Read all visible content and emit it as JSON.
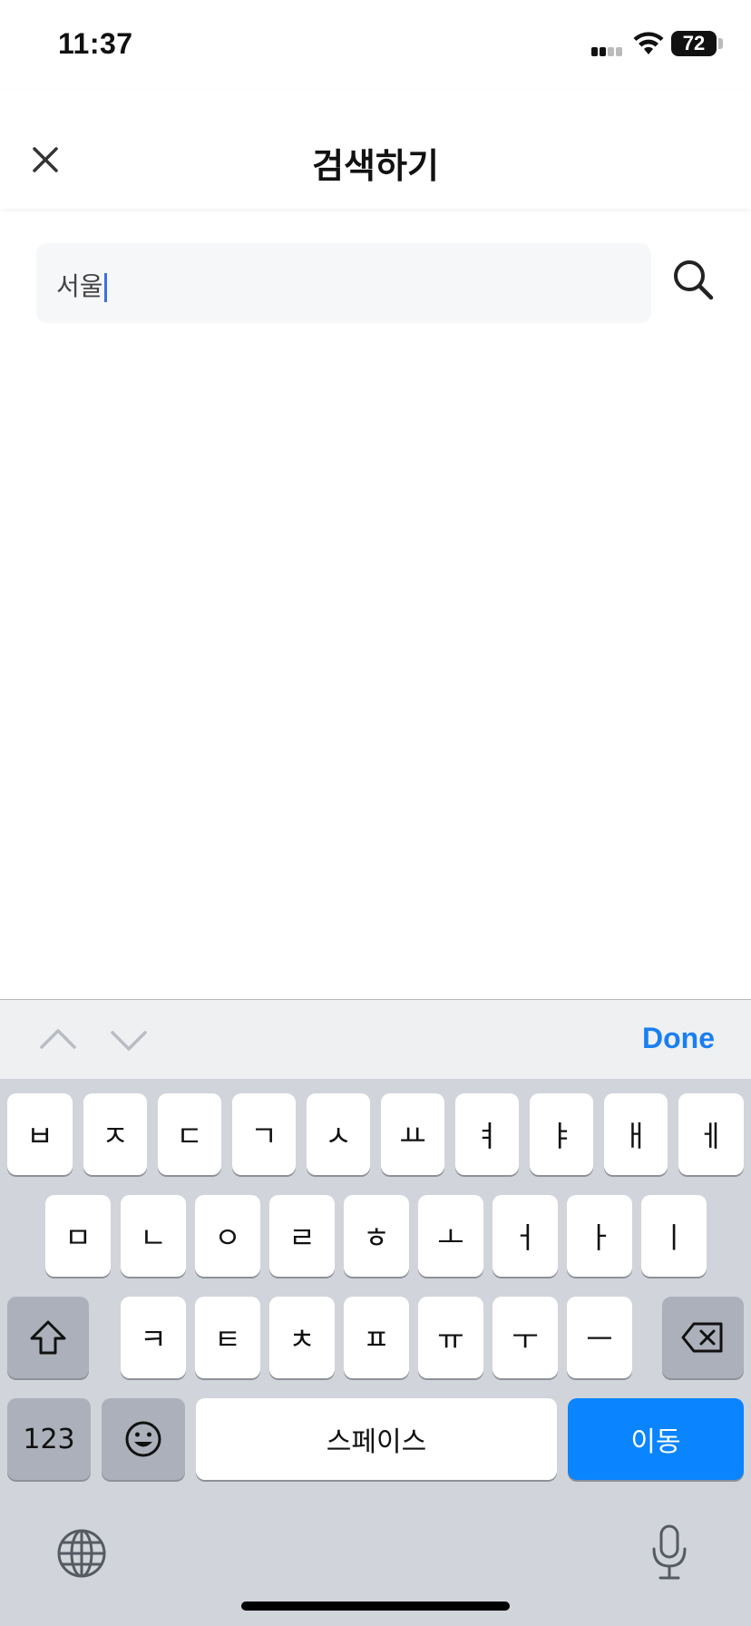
{
  "status_bar": {
    "time": "11:37",
    "battery": "72"
  },
  "header": {
    "title": "검색하기",
    "close_icon": "close-icon"
  },
  "search": {
    "value": "서울",
    "search_icon": "search-icon"
  },
  "toolbar": {
    "prev_icon": "chevron-up-icon",
    "next_icon": "chevron-down-icon",
    "done_label": "Done"
  },
  "keyboard": {
    "row1": [
      "ㅂ",
      "ㅈ",
      "ㄷ",
      "ㄱ",
      "ㅅ",
      "ㅛ",
      "ㅕ",
      "ㅑ",
      "ㅐ",
      "ㅔ"
    ],
    "row2": [
      "ㅁ",
      "ㄴ",
      "ㅇ",
      "ㄹ",
      "ㅎ",
      "ㅗ",
      "ㅓ",
      "ㅏ",
      "ㅣ"
    ],
    "row3": [
      "ㅋ",
      "ㅌ",
      "ㅊ",
      "ㅍ",
      "ㅠ",
      "ㅜ",
      "ㅡ"
    ],
    "numbers_label": "123",
    "space_label": "스페이스",
    "go_label": "이동",
    "icons": [
      "shift-icon",
      "backspace-icon",
      "emoji-icon",
      "globe-icon",
      "microphone-icon"
    ]
  },
  "colors": {
    "accent": "#1a7ff0",
    "go_key": "#0a84ff",
    "keyboard_bg": "#d1d4da",
    "caret": "#3d6fe0"
  }
}
